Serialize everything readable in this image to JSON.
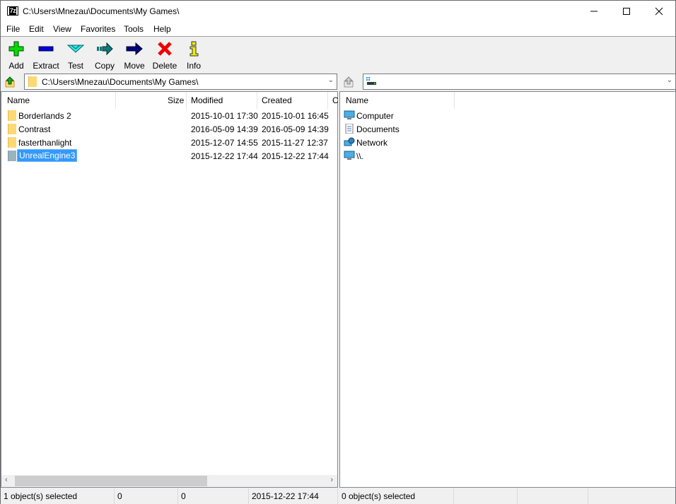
{
  "window": {
    "title": "C:\\Users\\Mnezau\\Documents\\My Games\\",
    "app_icon_text": "7z",
    "controls": {
      "minimize": "minimize-icon",
      "maximize": "maximize-icon",
      "close": "close-icon"
    }
  },
  "menu": [
    "File",
    "Edit",
    "View",
    "Favorites",
    "Tools",
    "Help"
  ],
  "toolbar": [
    {
      "label": "Add",
      "icon": "add-icon",
      "color": "#00cc00"
    },
    {
      "label": "Extract",
      "icon": "extract-icon",
      "color": "#0000cc"
    },
    {
      "label": "Test",
      "icon": "test-icon",
      "color": "#33dddd"
    },
    {
      "label": "Copy",
      "icon": "copy-icon",
      "color": "#117777"
    },
    {
      "label": "Move",
      "icon": "move-icon",
      "color": "#000066"
    },
    {
      "label": "Delete",
      "icon": "delete-icon",
      "color": "#ee0000"
    },
    {
      "label": "Info",
      "icon": "info-icon",
      "color": "#eeee00"
    }
  ],
  "left_pane": {
    "address": "C:\\Users\\Mnezau\\Documents\\My Games\\",
    "columns": [
      "Name",
      "Size",
      "Modified",
      "Created",
      "C"
    ],
    "rows": [
      {
        "name": "Borderlands 2",
        "size": "",
        "modified": "2015-10-01 17:30",
        "created": "2015-10-01 16:45",
        "selected": false
      },
      {
        "name": "Contrast",
        "size": "",
        "modified": "2016-05-09 14:39",
        "created": "2016-05-09 14:39",
        "selected": false
      },
      {
        "name": "fasterthanlight",
        "size": "",
        "modified": "2015-12-07 14:55",
        "created": "2015-11-27 12:37",
        "selected": false
      },
      {
        "name": "UnrealEngine3",
        "size": "",
        "modified": "2015-12-22 17:44",
        "created": "2015-12-22 17:44",
        "selected": true
      }
    ],
    "status": {
      "selected": "1 object(s) selected",
      "size": "0",
      "packed": "0",
      "modified": "2015-12-22 17:44"
    }
  },
  "right_pane": {
    "address": "",
    "columns": [
      "Name"
    ],
    "rows": [
      {
        "name": "Computer",
        "icon": "computer-icon"
      },
      {
        "name": "Documents",
        "icon": "documents-icon"
      },
      {
        "name": "Network",
        "icon": "network-icon"
      },
      {
        "name": "\\\\.",
        "icon": "computer-icon"
      }
    ],
    "status": {
      "selected": "0 object(s) selected",
      "size": "",
      "packed": "",
      "modified": ""
    }
  }
}
